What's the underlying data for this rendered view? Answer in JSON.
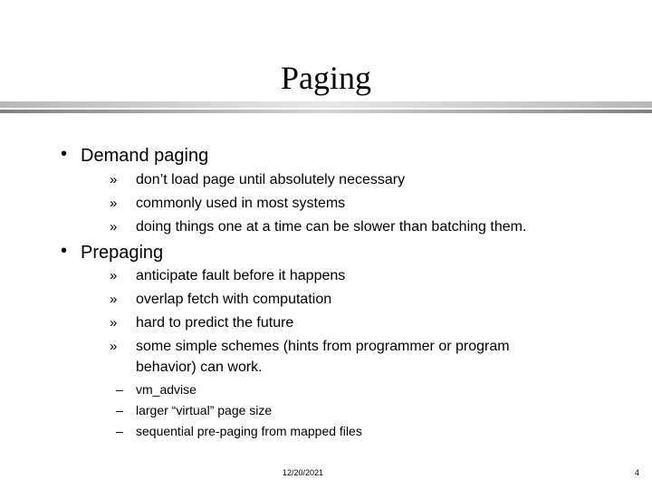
{
  "slide": {
    "title": "Paging",
    "sections": [
      {
        "heading": "Demand paging",
        "items": [
          "don’t load page until absolutely necessary",
          "commonly used in most systems",
          "doing things one at a time can  be slower than batching them."
        ]
      },
      {
        "heading": "Prepaging",
        "items": [
          "anticipate fault before it happens",
          "overlap fetch with computation",
          "hard to predict the future",
          "some simple schemes (hints from programmer or program",
          "behavior) can work."
        ],
        "subitems": [
          "vm_advise",
          "larger “virtual” page size",
          "sequential pre-paging from mapped files"
        ]
      }
    ],
    "bullet_glyph": "•",
    "sub_bullet_glyph": "»",
    "subsub_bullet_glyph": "–"
  },
  "footer": {
    "date": "12/20/2021",
    "page_number": "4"
  }
}
